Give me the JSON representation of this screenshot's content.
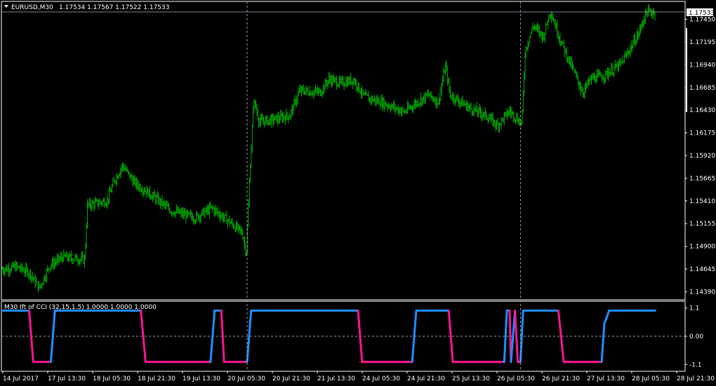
{
  "colors": {
    "background": "#000000",
    "bars": "#00b000",
    "frame": "#ffffff",
    "ift_up": "#1e90ff",
    "ift_down": "#ff1493",
    "grid": "#9aa0a6",
    "price_line": "#778899"
  },
  "chart_data": [
    {
      "type": "line",
      "subtype": "ohlc-bars",
      "symbol_label": "EURUSD,M30",
      "ohlc_header": "1.17534 1.17567 1.17522 1.17533",
      "current_price": "1.17533",
      "ylim": [
        1.1433,
        1.1762
      ],
      "y_ticks": [
        "1.17450",
        "1.17195",
        "1.16940",
        "1.16685",
        "1.16430",
        "1.16175",
        "1.15920",
        "1.15665",
        "1.15410",
        "1.15155",
        "1.14900",
        "1.14645",
        "1.14390"
      ],
      "x_ticks": [
        "14 Jul 2017",
        "17 Jul 13:30",
        "18 Jul 05:30",
        "18 Jul 21:30",
        "19 Jul 13:30",
        "20 Jul 05:30",
        "20 Jul 21:30",
        "21 Jul 13:30",
        "24 Jul 05:30",
        "24 Jul 21:30",
        "25 Jul 13:30",
        "26 Jul 05:30",
        "26 Jul 21:30",
        "27 Jul 13:30",
        "28 Jul 05:30",
        "28 Jul 21:30"
      ],
      "x_range": [
        0,
        1000
      ],
      "price_path": [
        [
          0,
          1.1464
        ],
        [
          20,
          1.1467
        ],
        [
          40,
          1.1461
        ],
        [
          55,
          1.1443
        ],
        [
          70,
          1.1468
        ],
        [
          90,
          1.1478
        ],
        [
          122,
          1.1475
        ],
        [
          126,
          1.1536
        ],
        [
          155,
          1.1541
        ],
        [
          165,
          1.1562
        ],
        [
          178,
          1.1581
        ],
        [
          195,
          1.1562
        ],
        [
          220,
          1.1548
        ],
        [
          250,
          1.153
        ],
        [
          285,
          1.1522
        ],
        [
          310,
          1.1533
        ],
        [
          335,
          1.1518
        ],
        [
          355,
          1.1505
        ],
        [
          361,
          1.1482
        ],
        [
          366,
          1.1572
        ],
        [
          372,
          1.1655
        ],
        [
          380,
          1.163
        ],
        [
          400,
          1.1632
        ],
        [
          425,
          1.1637
        ],
        [
          440,
          1.1665
        ],
        [
          470,
          1.1663
        ],
        [
          483,
          1.1678
        ],
        [
          500,
          1.1673
        ],
        [
          520,
          1.1677
        ],
        [
          535,
          1.1658
        ],
        [
          560,
          1.1652
        ],
        [
          595,
          1.1641
        ],
        [
          610,
          1.165
        ],
        [
          630,
          1.166
        ],
        [
          645,
          1.1652
        ],
        [
          655,
          1.1693
        ],
        [
          662,
          1.166
        ],
        [
          690,
          1.1646
        ],
        [
          715,
          1.1637
        ],
        [
          732,
          1.1626
        ],
        [
          750,
          1.1642
        ],
        [
          768,
          1.1628
        ],
        [
          773,
          1.171
        ],
        [
          785,
          1.1738
        ],
        [
          800,
          1.1725
        ],
        [
          810,
          1.1755
        ],
        [
          825,
          1.1722
        ],
        [
          840,
          1.1695
        ],
        [
          858,
          1.1663
        ],
        [
          870,
          1.1678
        ],
        [
          890,
          1.1682
        ],
        [
          915,
          1.1695
        ],
        [
          940,
          1.1728
        ],
        [
          952,
          1.1753
        ],
        [
          965,
          1.1753
        ]
      ]
    },
    {
      "type": "line",
      "label": "M30 Ift of CCI (32,15,1.5) 1.0000 1.0000 1.0000",
      "ylim": [
        -1.2,
        1.2
      ],
      "y_ticks": [
        "1.1",
        "0.00",
        "-1.1"
      ],
      "levels": [
        1.0,
        0.0,
        -1.0
      ],
      "steps": [
        [
          0,
          1.0
        ],
        [
          40,
          1.0
        ],
        [
          46,
          -1.0
        ],
        [
          72,
          -1.0
        ],
        [
          78,
          1.0
        ],
        [
          80,
          1.0
        ],
        [
          205,
          1.0
        ],
        [
          212,
          -1.0
        ],
        [
          308,
          -1.0
        ],
        [
          314,
          1.0
        ],
        [
          324,
          1.0
        ],
        [
          328,
          -1.0
        ],
        [
          362,
          -1.0
        ],
        [
          368,
          1.0
        ],
        [
          526,
          1.0
        ],
        [
          532,
          -1.0
        ],
        [
          606,
          -1.0
        ],
        [
          612,
          1.0
        ],
        [
          660,
          1.0
        ],
        [
          666,
          -1.0
        ],
        [
          742,
          -1.0
        ],
        [
          746,
          1.0
        ],
        [
          750,
          1.0
        ],
        [
          752,
          -1.0
        ],
        [
          758,
          1.0
        ],
        [
          762,
          -1.0
        ],
        [
          766,
          -1.0
        ],
        [
          770,
          1.0
        ],
        [
          822,
          1.0
        ],
        [
          830,
          -1.0
        ],
        [
          886,
          -1.0
        ],
        [
          890,
          0.5
        ],
        [
          893,
          0.7
        ],
        [
          897,
          1.0
        ],
        [
          965,
          1.0
        ]
      ],
      "vlines": [
        362,
        766
      ]
    }
  ]
}
